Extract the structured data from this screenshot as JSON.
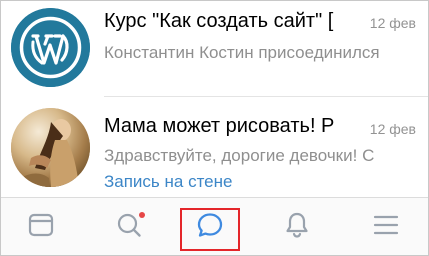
{
  "dialogs": [
    {
      "title": "Курс \"Как создать сайт\" [",
      "date": "12 фев",
      "preview": "Константин Костин присоединился",
      "avatar_icon": "wordpress-logo-icon"
    },
    {
      "title": "Мама может рисовать! Р",
      "date": "12 фев",
      "preview": "Здравствуйте, дорогие девочки! С",
      "link": "Запись на стене",
      "avatar_icon": "photo-avatar"
    }
  ],
  "tabbar": {
    "tabs": [
      {
        "icon": "news-feed-icon",
        "active": false
      },
      {
        "icon": "search-icon",
        "active": false,
        "has_notification": true
      },
      {
        "icon": "messages-icon",
        "active": true
      },
      {
        "icon": "notifications-bell-icon",
        "active": false
      },
      {
        "icon": "menu-icon",
        "active": false
      }
    ]
  },
  "colors": {
    "accent_blue": "#3f8ae0",
    "link_blue": "#3c86c7",
    "wp_blue": "#22799c",
    "highlight_red": "#e4262a",
    "badge_red": "#e64646",
    "icon_gray": "#99a2ad",
    "secondary_text": "#8f8f8f"
  }
}
